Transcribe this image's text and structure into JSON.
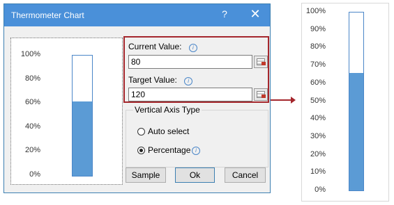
{
  "dialog": {
    "title": "Thermometer Chart",
    "help_glyph": "?",
    "close_glyph": "✕"
  },
  "preview_chart": {
    "y_ticks": [
      "100%",
      "80%",
      "60%",
      "40%",
      "20%",
      "0%"
    ],
    "fill_fraction": 0.617,
    "fill_color": "#5b9bd5"
  },
  "fields": {
    "current_value_label": "Current Value:",
    "current_value": "80",
    "target_value_label": "Target Value:",
    "target_value": "120",
    "info_glyph": "i"
  },
  "axis_type": {
    "title": "Vertical Axis Type",
    "auto_select_label": "Auto select",
    "percentage_label": "Percentage",
    "selected": "Percentage"
  },
  "buttons": {
    "sample": "Sample",
    "ok": "Ok",
    "cancel": "Cancel"
  },
  "result_chart": {
    "y_ticks": [
      "100%",
      "90%",
      "80%",
      "70%",
      "60%",
      "50%",
      "40%",
      "30%",
      "20%",
      "10%",
      "0%"
    ],
    "fill_fraction": 0.66,
    "fill_color": "#5b9bd5"
  },
  "colors": {
    "titlebar": "#4a90d9",
    "highlight_border": "#a4262c",
    "arrow": "#a4262c"
  }
}
